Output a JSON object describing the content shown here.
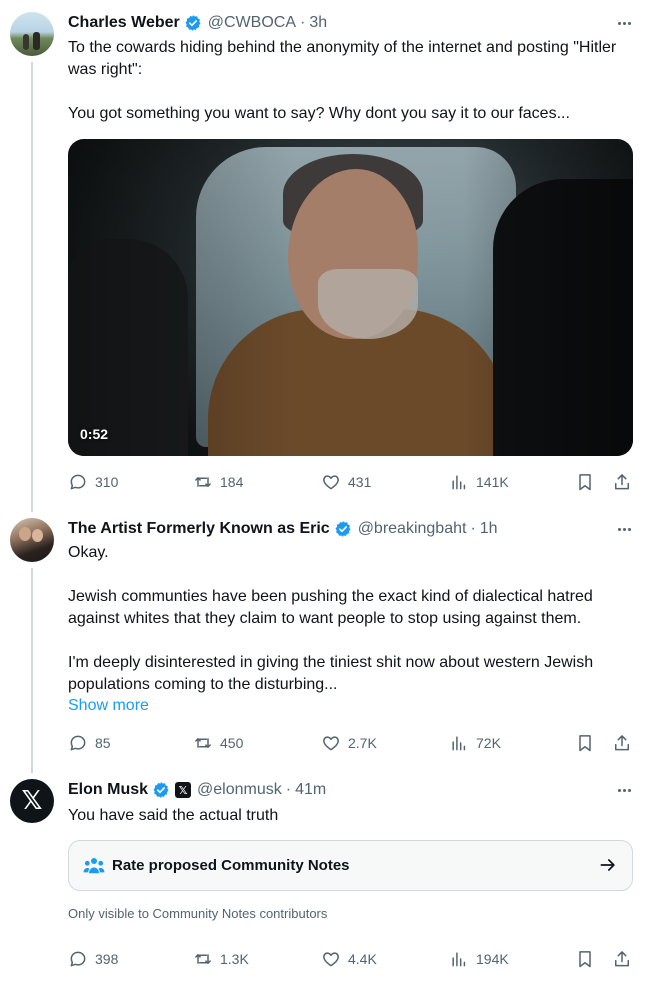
{
  "tweets": [
    {
      "name": "Charles Weber",
      "handle": "@CWBOCA",
      "time": "3h",
      "paragraphs": [
        "To the cowards hiding behind the anonymity of the internet and posting \"Hitler was right\":",
        "You got something you want to say? Why dont you say it to our faces..."
      ],
      "video_duration": "0:52",
      "stats": {
        "replies": "310",
        "reposts": "184",
        "likes": "431",
        "views": "141K"
      }
    },
    {
      "name": "The Artist Formerly Known as Eric",
      "handle": "@breakingbaht",
      "time": "1h",
      "paragraphs": [
        "Okay.",
        "Jewish communties have been pushing the exact kind of dialectical hatred against whites that they claim to want people to stop using against them.",
        "I'm deeply disinterested in giving the tiniest shit now about western Jewish populations coming to the disturbing..."
      ],
      "show_more": "Show more",
      "stats": {
        "replies": "85",
        "reposts": "450",
        "likes": "2.7K",
        "views": "72K"
      }
    },
    {
      "name": "Elon Musk",
      "handle": "@elonmusk",
      "time": "41m",
      "paragraphs": [
        "You have said the actual truth"
      ],
      "community_notes_label": "Rate proposed Community Notes",
      "visibility_note": "Only visible to Community Notes contributors",
      "stats": {
        "replies": "398",
        "reposts": "1.3K",
        "likes": "4.4K",
        "views": "194K"
      }
    }
  ],
  "colors": {
    "accent": "#1d9bf0",
    "text": "#0f1419",
    "muted": "#536471",
    "border": "#cfd9de"
  },
  "icons": [
    "verified-icon",
    "more-icon",
    "reply-icon",
    "repost-icon",
    "like-icon",
    "views-icon",
    "bookmark-icon",
    "share-icon",
    "community-notes-icon",
    "arrow-right-icon",
    "x-logo-icon"
  ]
}
